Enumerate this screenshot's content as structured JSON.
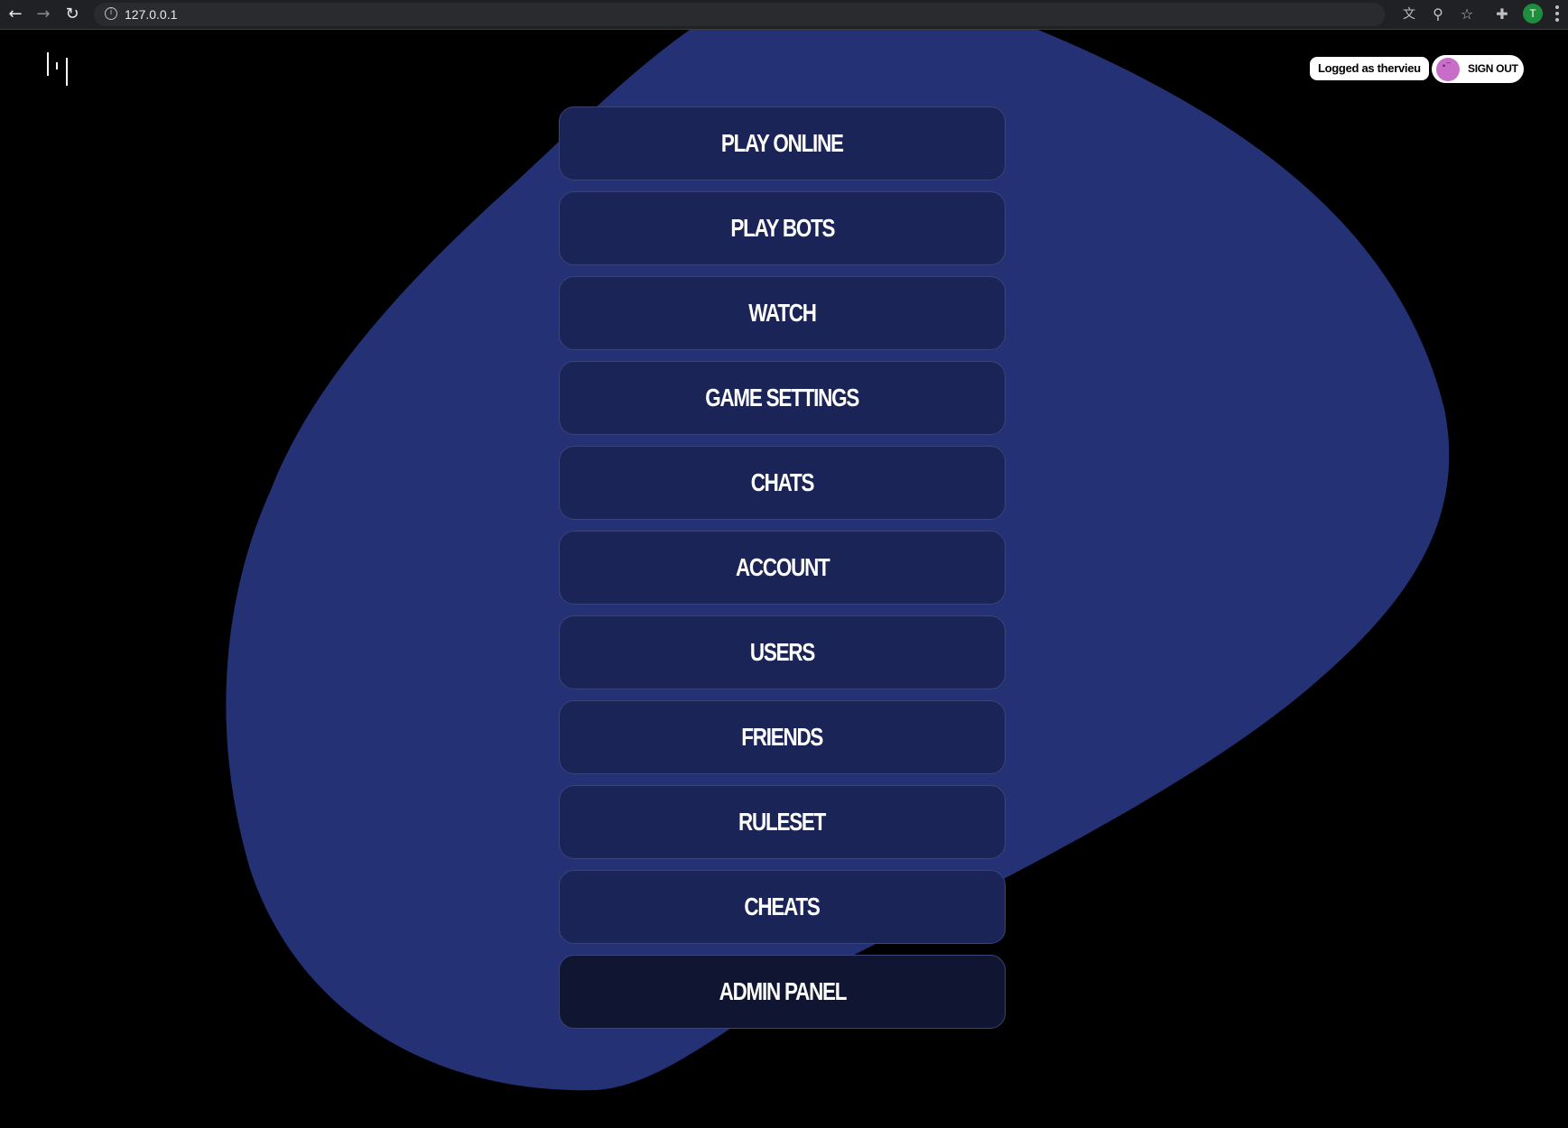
{
  "browser": {
    "url": "127.0.0.1",
    "profile_initial": "T",
    "icons": [
      "back-icon",
      "forward-icon",
      "reload-icon",
      "info-icon",
      "translate-icon",
      "zoom-icon",
      "star-icon",
      "extensions-icon",
      "menu-icon"
    ]
  },
  "header": {
    "logged_as": "Logged as thervieu",
    "sign_out_label": "SIGN OUT"
  },
  "colors": {
    "background": "#000000",
    "blob": "#243275",
    "button_fill": "#1b2456",
    "button_border": "#3a4478",
    "avatar": "#c86ec8"
  },
  "menu": {
    "items": [
      {
        "label": "PLAY ONLINE"
      },
      {
        "label": "PLAY BOTS"
      },
      {
        "label": "WATCH"
      },
      {
        "label": "GAME SETTINGS"
      },
      {
        "label": "CHATS"
      },
      {
        "label": "ACCOUNT"
      },
      {
        "label": "USERS"
      },
      {
        "label": "FRIENDS"
      },
      {
        "label": "RULESET"
      },
      {
        "label": "CHEATS"
      },
      {
        "label": "ADMIN PANEL"
      }
    ]
  }
}
